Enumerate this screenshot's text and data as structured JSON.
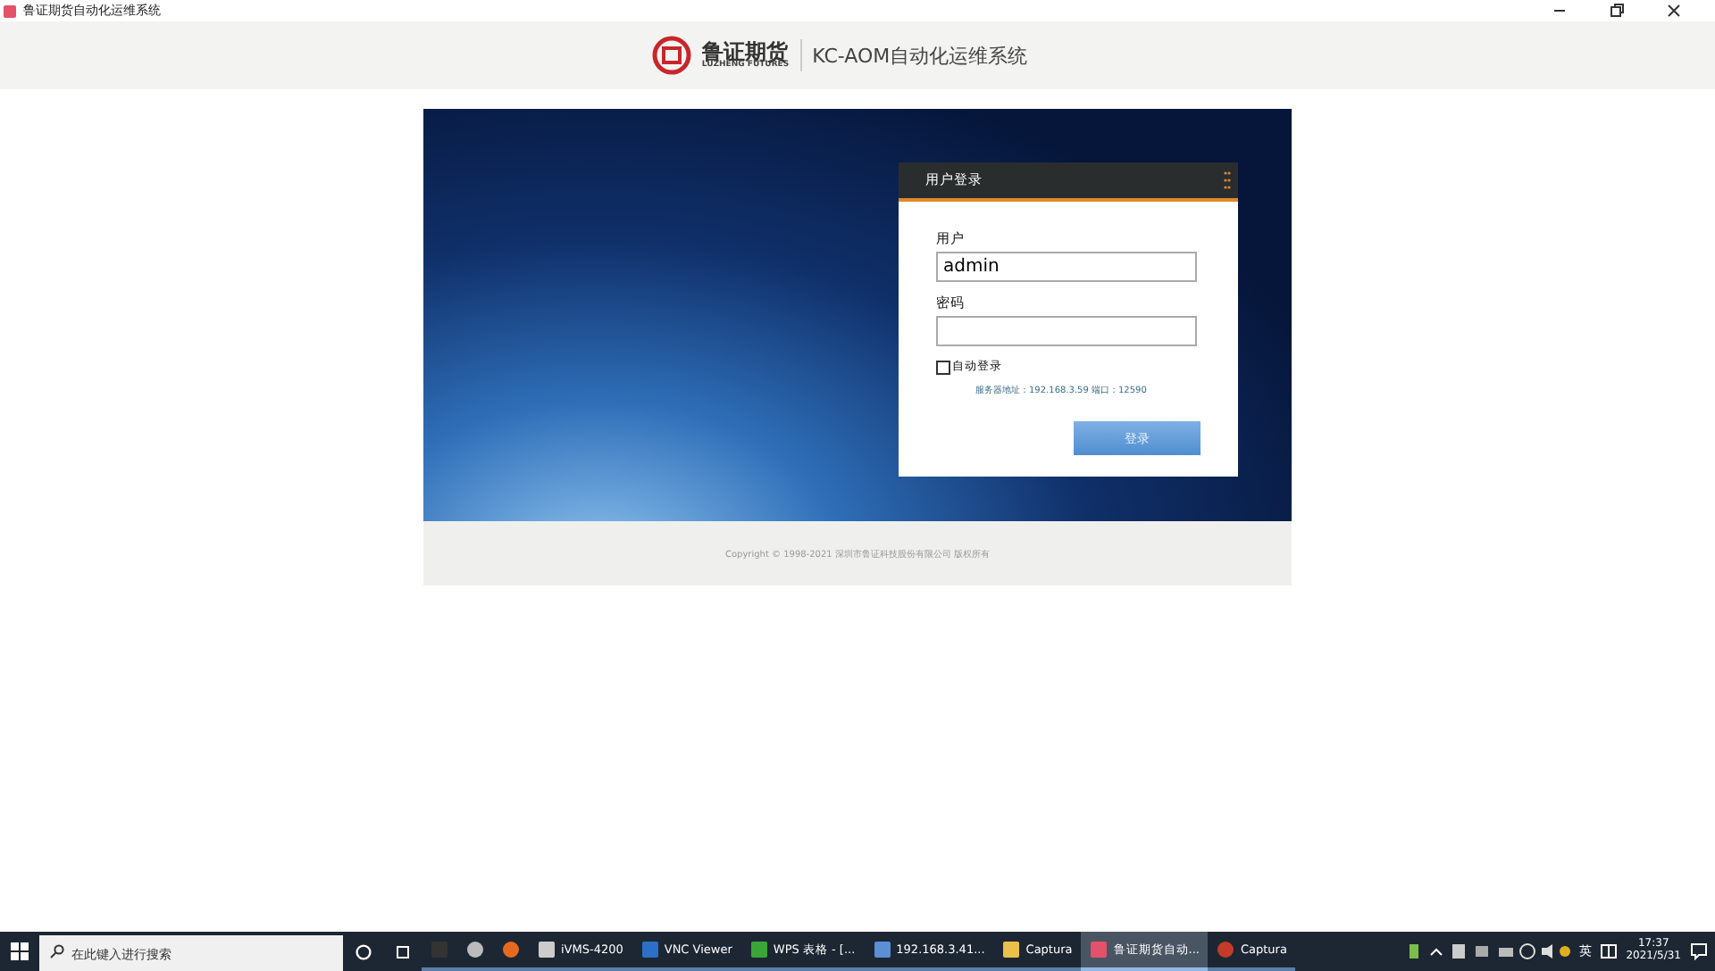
{
  "window": {
    "title": "鲁证期货自动化运维系统"
  },
  "header": {
    "logo_cn": "鲁证期货",
    "logo_en": "LUZHENG FUTURES",
    "system_name": "KC-AOM自动化运维系统"
  },
  "login": {
    "title": "用户登录",
    "user_label": "用户",
    "user_value": "admin",
    "password_label": "密码",
    "auto_login": {
      "label": "自动登录",
      "checked": false
    },
    "server_info": "服务器地址：192.168.3.59 端口：12590",
    "submit": "登录"
  },
  "footer": {
    "copyright": "Copyright © 1998-2021 深圳市鲁证科技股份有限公司 版权所有"
  },
  "taskbar": {
    "search": {
      "placeholder": "在此键入进行搜索"
    },
    "apps": [
      {
        "kind": "terminal",
        "selected": false
      },
      {
        "kind": "cloud",
        "selected": false
      },
      {
        "kind": "browser",
        "selected": false
      },
      {
        "kind": "camera",
        "label": "iVMS-4200",
        "selected": false
      },
      {
        "kind": "vnc",
        "label": "VNC Viewer",
        "selected": false
      },
      {
        "kind": "sheet",
        "label": "WPS 表格 - [...",
        "selected": false
      },
      {
        "kind": "remote",
        "label": "192.168.3.41...",
        "selected": false
      },
      {
        "kind": "folder",
        "label": "Captura",
        "selected": false
      },
      {
        "kind": "app",
        "label": "鲁证期货自动...",
        "selected": true
      },
      {
        "kind": "record",
        "label": "Captura",
        "selected": false
      }
    ],
    "ime": "英",
    "time": "17:37",
    "date": "2021/5/31"
  }
}
